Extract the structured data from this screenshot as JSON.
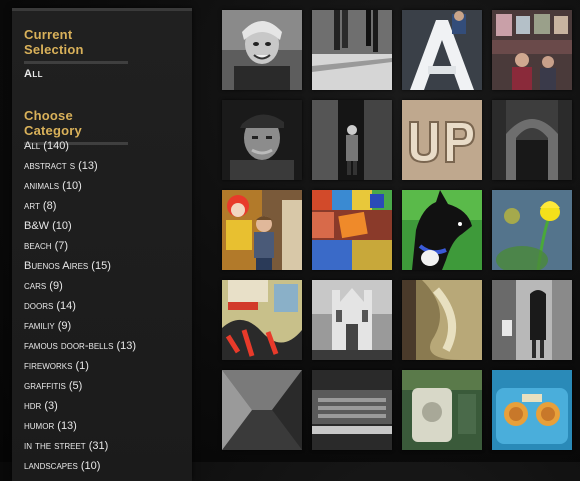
{
  "sidebar": {
    "current_title": "Current Selection",
    "current_value": "All",
    "category_title": "Choose Category",
    "categories": [
      "All (140)",
      "abstract s (13)",
      "animals (10)",
      "art (8)",
      "B&W (10)",
      "beach (7)",
      "Buenos Aires (15)",
      "cars (9)",
      "doors (14)",
      "familiy (9)",
      "famous door-bells (13)",
      "fireworks (1)",
      "graffitis (5)",
      "hdr (3)",
      "humor (13)",
      "in the street (31)",
      "landscapes (10)"
    ]
  },
  "gallery": {
    "images": [
      "portrait-clown-hat",
      "street-legs",
      "letter-a-sculpture",
      "market-stall",
      "old-man-cap",
      "man-in-doorway",
      "up-sign",
      "arched-corridor",
      "clown-and-boy",
      "graffiti-wall-sign",
      "black-dog",
      "yellow-tulip",
      "graffiti-poster",
      "church-bw",
      "peeling-wall",
      "woman-on-street",
      "corridor-bw",
      "old-car-bw",
      "doorbell-device",
      "blue-radio"
    ]
  }
}
